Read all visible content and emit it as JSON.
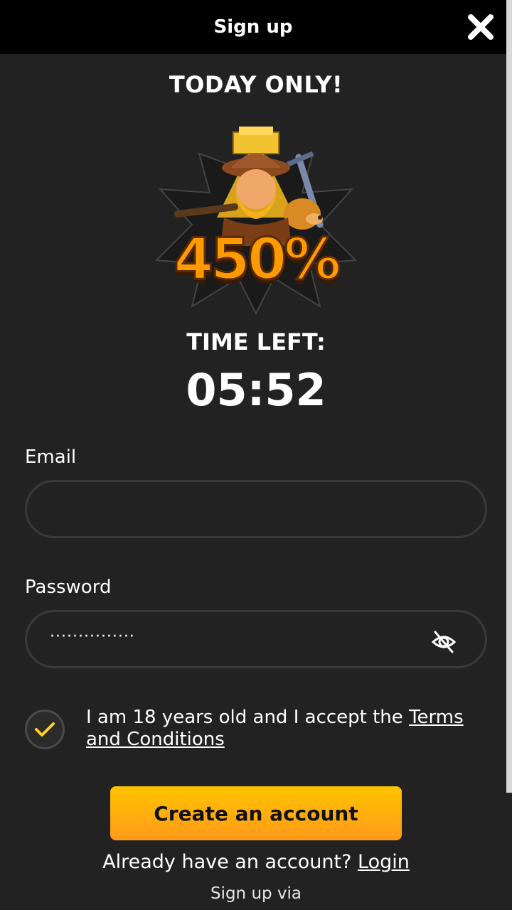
{
  "header": {
    "title": "Sign up"
  },
  "promo": {
    "headline": "TODAY ONLY!",
    "bonus": "450%",
    "time_left_label": "TIME LEFT:",
    "timer": "05:52"
  },
  "form": {
    "email_label": "Email",
    "email_value": "",
    "password_label": "Password",
    "password_masked": "···············",
    "terms_prefix": "I am 18 years old and I accept the ",
    "terms_link": "Terms and Conditions",
    "terms_checked": true,
    "create_button": "Create an account",
    "login_prompt": "Already have an account? ",
    "login_link": "Login",
    "signup_via": "Sign up via"
  },
  "colors": {
    "background": "#222222",
    "header": "#000000",
    "accent": "#ffc400",
    "check": "#ffd21a"
  },
  "icons": {
    "close": "close-icon",
    "eye": "eye-slash-icon",
    "check": "checkmark-icon"
  }
}
